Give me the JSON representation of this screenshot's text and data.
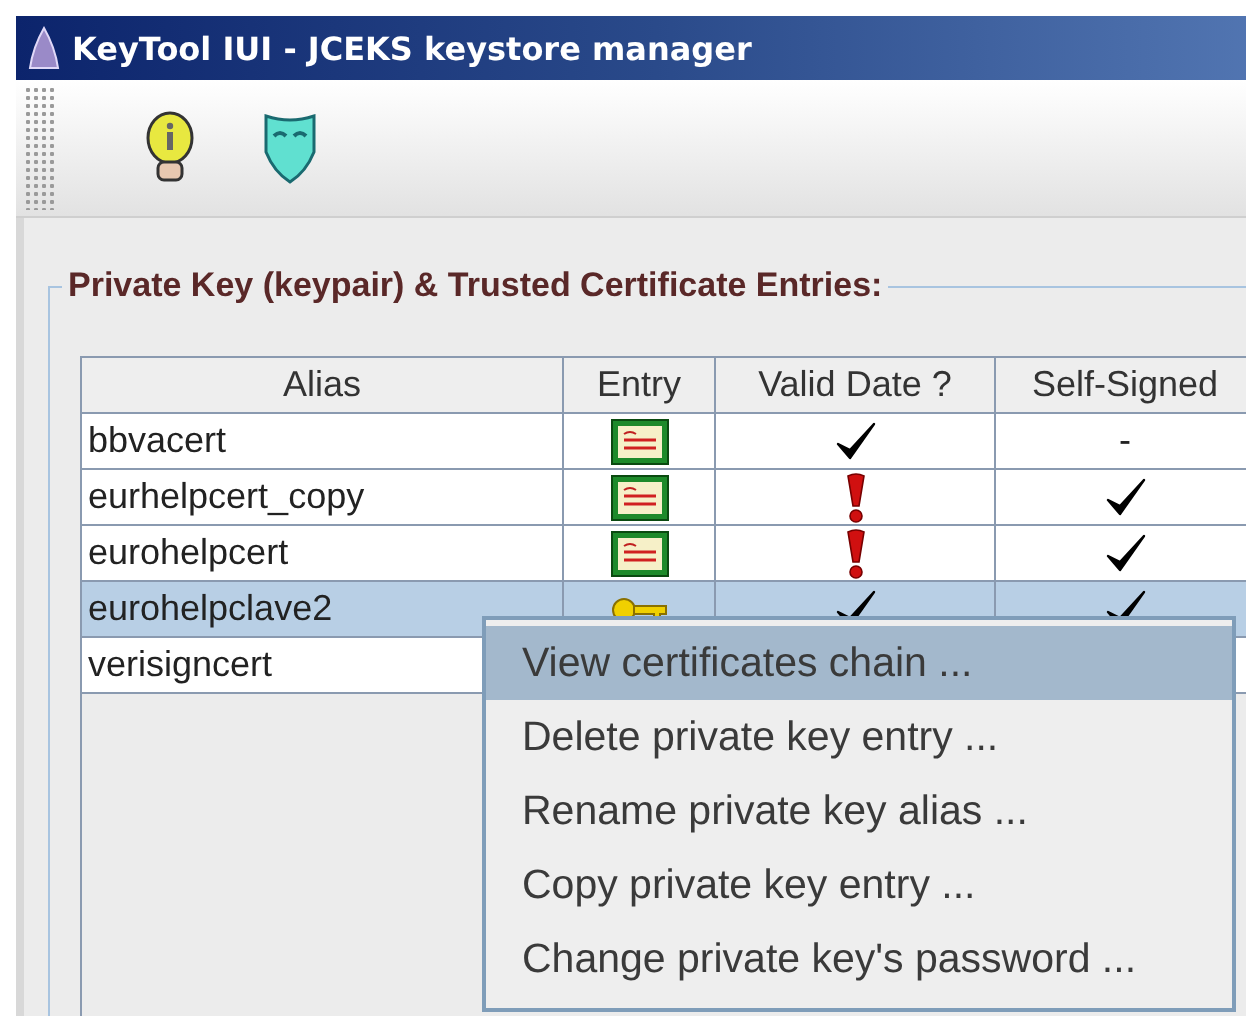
{
  "window": {
    "title": "KeyTool IUI - JCEKS keystore manager"
  },
  "group": {
    "title": "Private Key (keypair) & Trusted Certificate Entries:"
  },
  "table": {
    "columns": [
      "Alias",
      "Entry",
      "Valid Date ?",
      "Self-Signed"
    ],
    "rows": [
      {
        "alias": "bbvacert",
        "selected": false,
        "entry": {
          "kind": "certificate"
        },
        "valid": {
          "kind": "check"
        },
        "self_signed": {
          "kind": "text",
          "text": "-"
        }
      },
      {
        "alias": "eurhelpcert_copy",
        "selected": false,
        "entry": {
          "kind": "certificate"
        },
        "valid": {
          "kind": "warning"
        },
        "self_signed": {
          "kind": "check"
        }
      },
      {
        "alias": "eurohelpcert",
        "selected": false,
        "entry": {
          "kind": "certificate"
        },
        "valid": {
          "kind": "warning"
        },
        "self_signed": {
          "kind": "check"
        }
      },
      {
        "alias": "eurohelpclave2",
        "selected": true,
        "entry": {
          "kind": "key"
        },
        "valid": {
          "kind": "check"
        },
        "self_signed": {
          "kind": "check"
        }
      },
      {
        "alias": "verisigncert",
        "selected": false
      }
    ]
  },
  "context_menu": {
    "items": [
      {
        "label": "View certificates chain ...",
        "selected": true
      },
      {
        "label": "Delete private key entry ...",
        "selected": false
      },
      {
        "label": "Rename private key alias ...",
        "selected": false
      },
      {
        "label": "Copy private key entry ...",
        "selected": false
      },
      {
        "label": "Change private key's password ...",
        "selected": false
      }
    ]
  }
}
